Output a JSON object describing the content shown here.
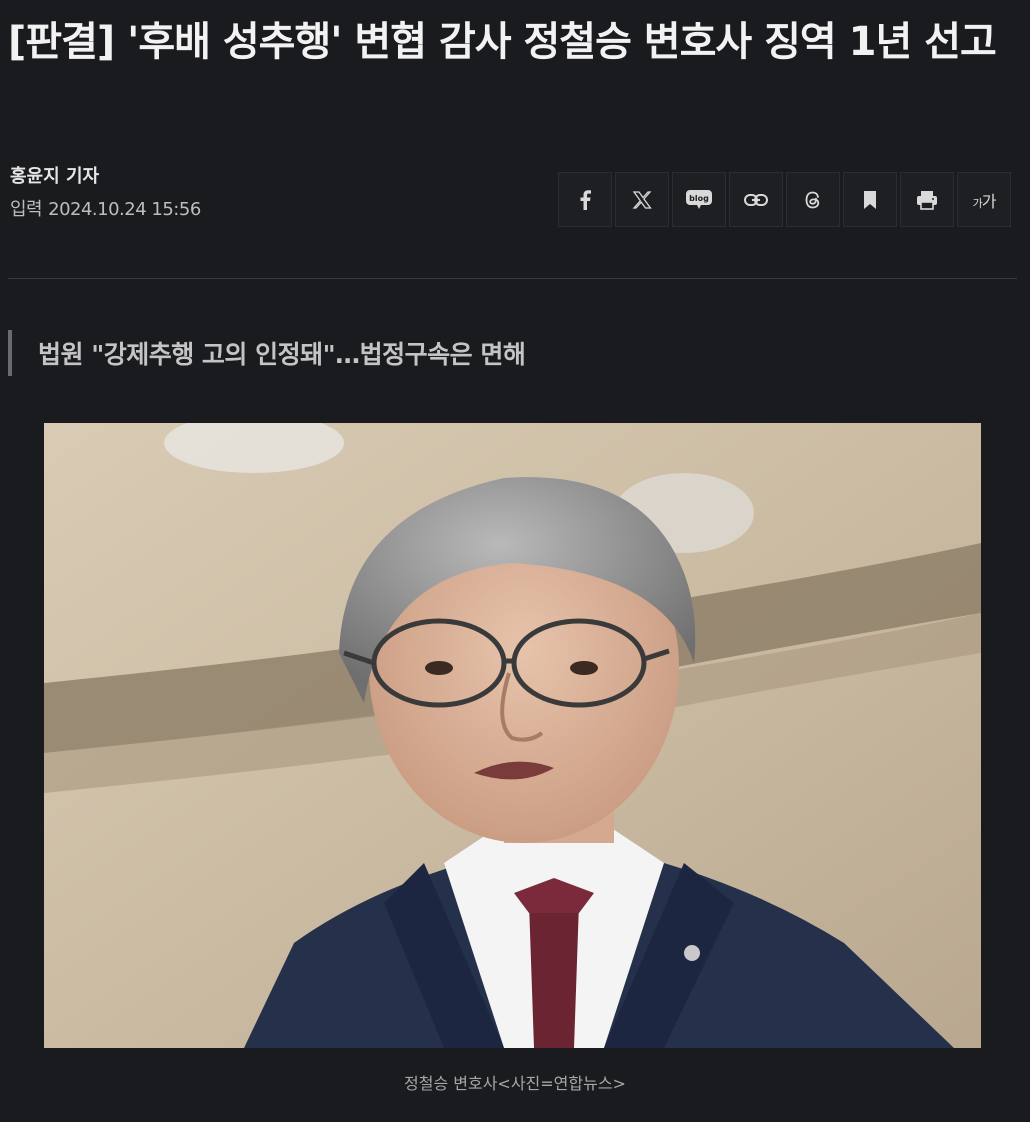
{
  "article": {
    "headline": "[판결] '후배 성추행' 변협 감사 정철승 변호사 징역 1년 선고",
    "reporter": "홍윤지 기자",
    "date_label": "입력",
    "date_value": "2024.10.24 15:56",
    "subtitle": "법원 \"강제추행 고의 인정돼\"…법정구속은 면해",
    "photo_caption": "정철승 변호사<사진=연합뉴스>"
  },
  "share_toolbar": {
    "buttons": [
      {
        "icon": "facebook-icon",
        "label": "f"
      },
      {
        "icon": "x-icon",
        "label": "𝕏"
      },
      {
        "icon": "blog-icon",
        "label": "blog"
      },
      {
        "icon": "link-icon"
      },
      {
        "icon": "threads-icon"
      },
      {
        "icon": "bookmark-icon"
      },
      {
        "icon": "print-icon"
      },
      {
        "icon": "font-size-icon",
        "label_small": "가",
        "label_large": "가"
      }
    ]
  }
}
